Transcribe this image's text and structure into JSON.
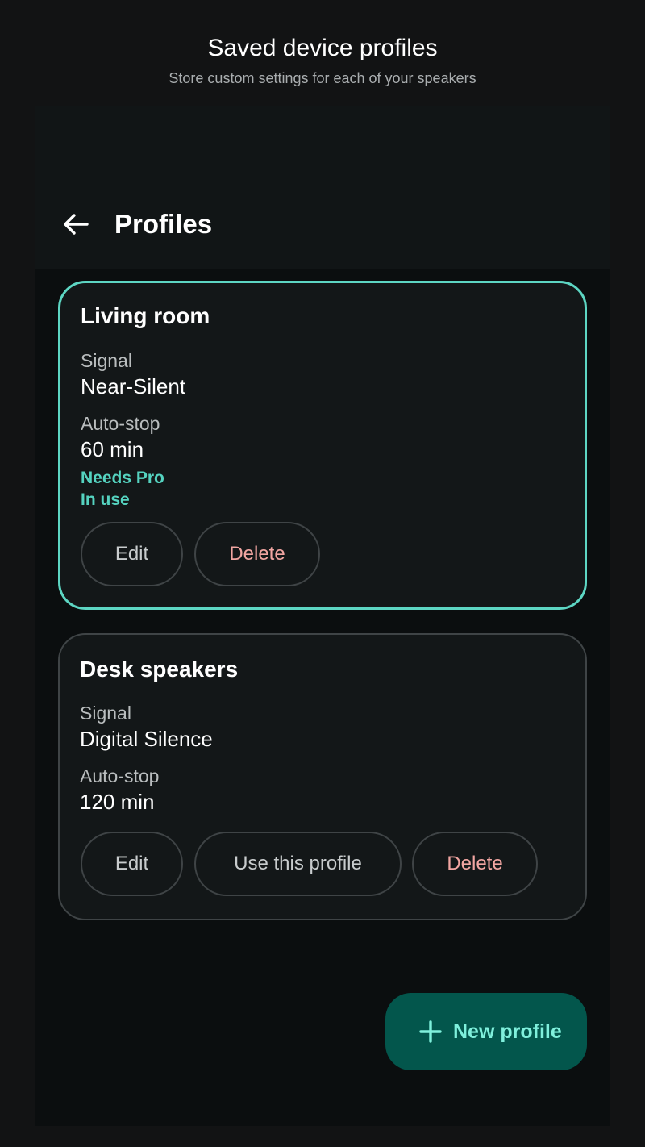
{
  "header": {
    "title": "Saved device profiles",
    "subtitle": "Store custom settings for each of your speakers"
  },
  "topbar": {
    "back_icon": "arrow-back-icon",
    "title": "Profiles"
  },
  "profiles": [
    {
      "name": "Living room",
      "signal_label": "Signal",
      "signal_value": "Near-Silent",
      "autostop_label": "Auto-stop",
      "autostop_value": "60 min",
      "tags": [
        "Needs Pro",
        "In use"
      ],
      "active": true,
      "buttons": {
        "edit": "Edit",
        "delete": "Delete"
      }
    },
    {
      "name": "Desk speakers",
      "signal_label": "Signal",
      "signal_value": "Digital Silence",
      "autostop_label": "Auto-stop",
      "autostop_value": "120 min",
      "active": false,
      "buttons": {
        "edit": "Edit",
        "use": "Use this profile",
        "delete": "Delete"
      }
    }
  ],
  "fab": {
    "icon": "plus-icon",
    "label": "New profile"
  },
  "colors": {
    "accent": "#5dd6c3",
    "danger": "#f2a6a2",
    "fab_background": "#03564c",
    "fab_foreground": "#7ff0dc"
  }
}
